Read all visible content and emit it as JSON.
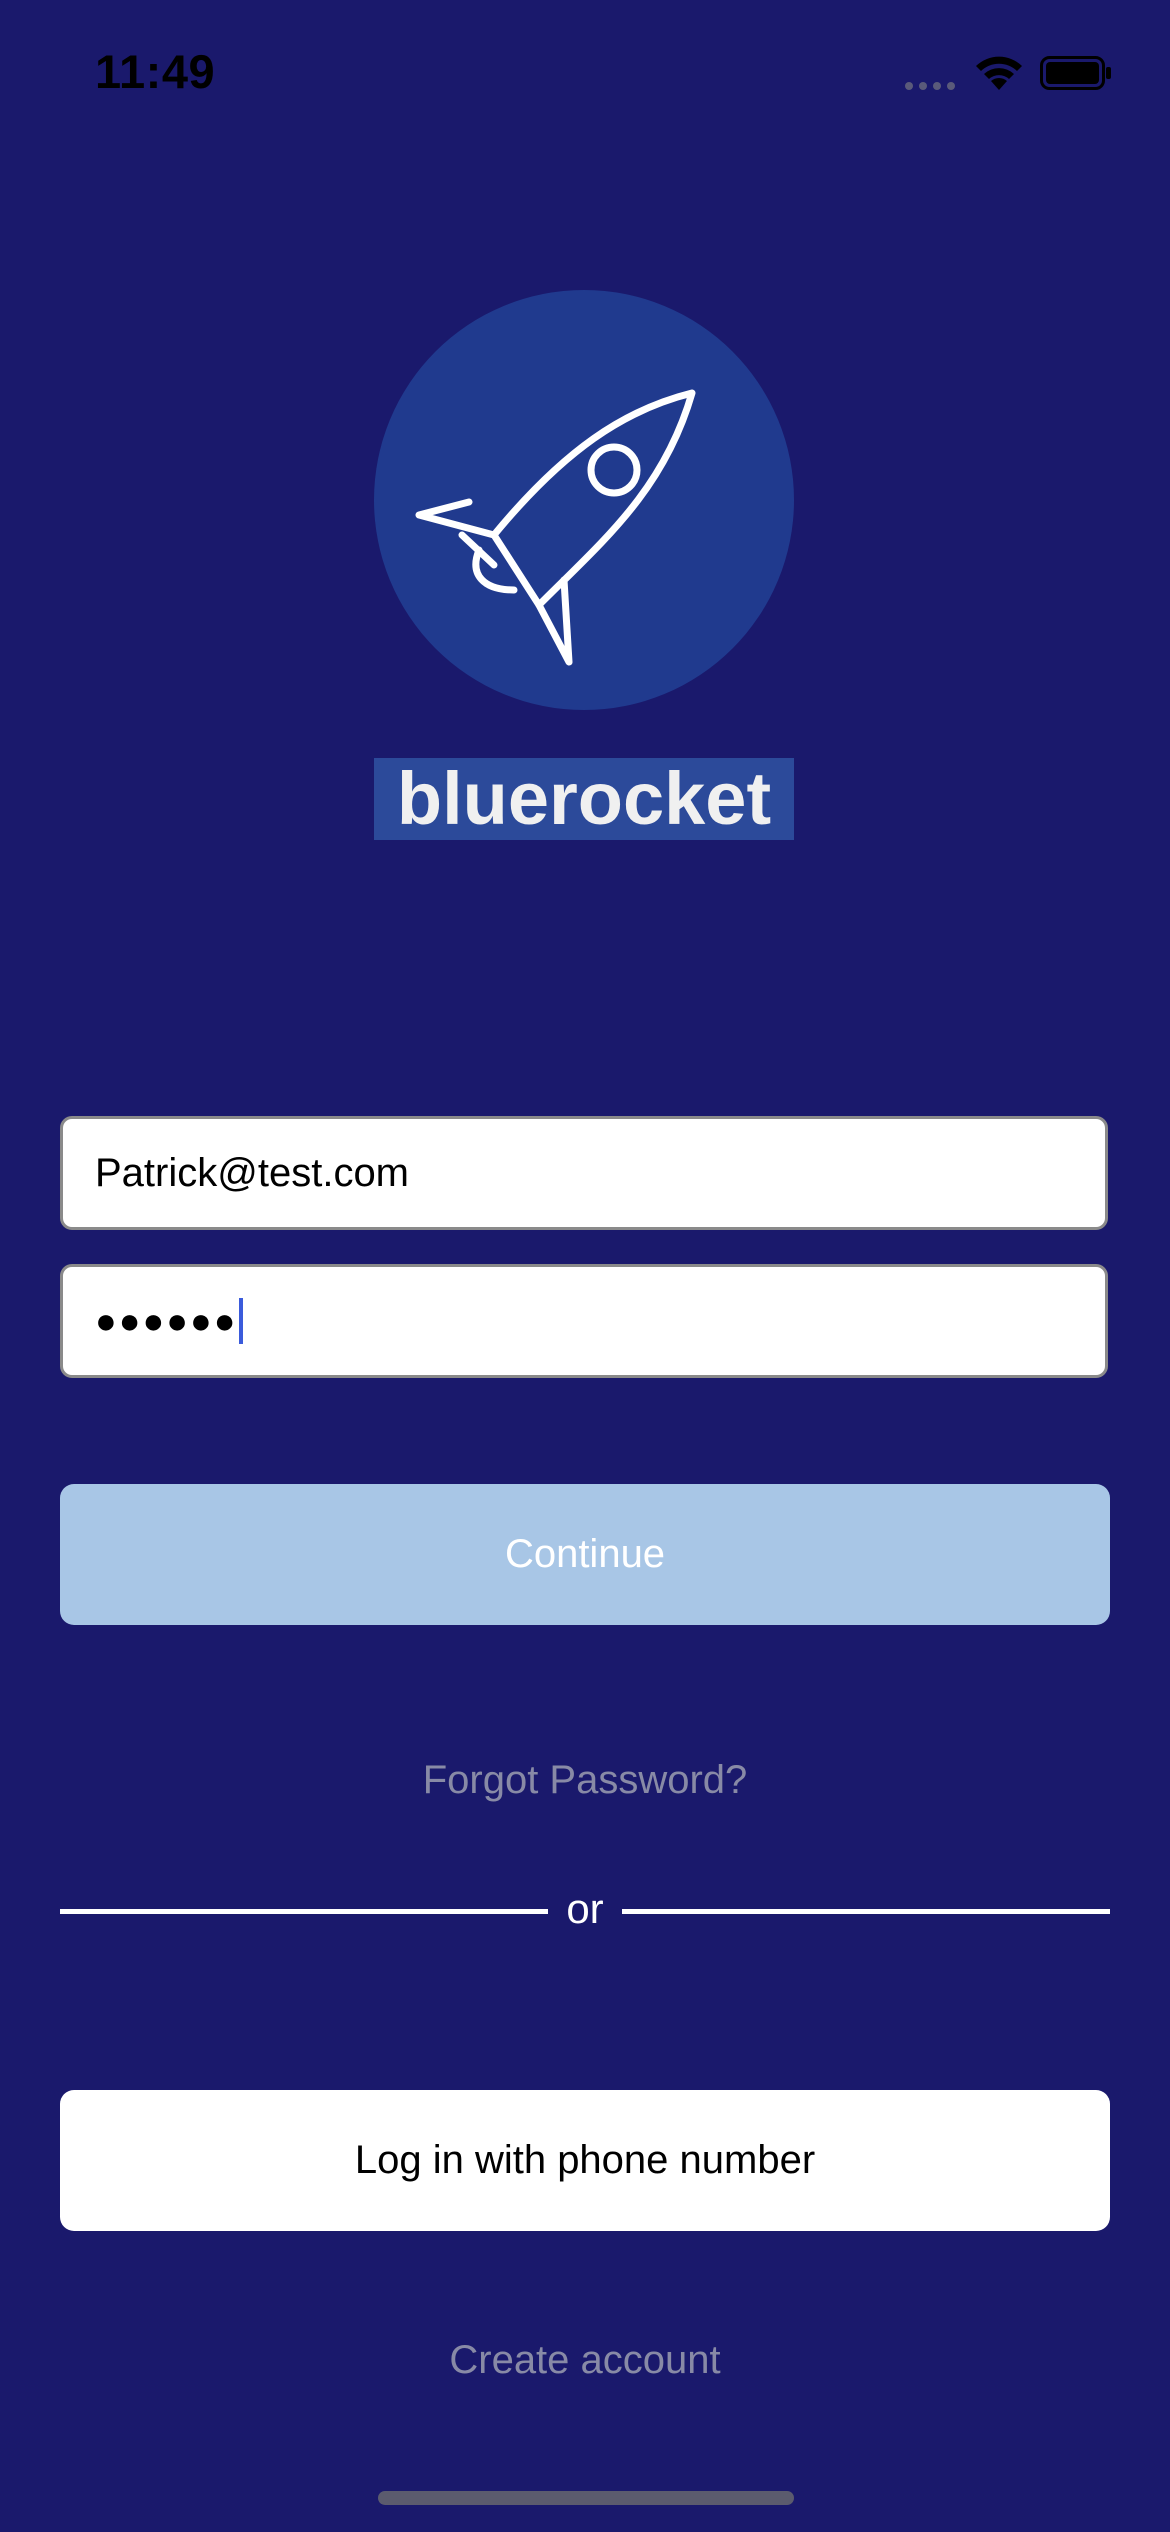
{
  "status_bar": {
    "time": "11:49"
  },
  "brand": {
    "name": "bluerocket",
    "logo_icon": "rocket-icon",
    "logo_background": "#203a8e"
  },
  "login_form": {
    "email_value": "Patrick@test.com",
    "password_masked": "●●●●●●",
    "continue_label": "Continue"
  },
  "links": {
    "forgot_password": "Forgot Password?",
    "divider_text": "or",
    "phone_login": "Log in with phone number",
    "create_account": "Create account"
  },
  "colors": {
    "background": "#1a196c",
    "continue_button_disabled": "#a8c6e6",
    "link_text": "#888aa6",
    "caret": "#3b5bdb"
  }
}
